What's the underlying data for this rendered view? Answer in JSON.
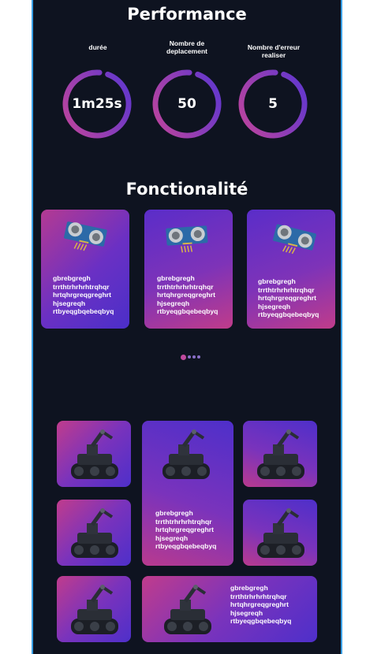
{
  "performance": {
    "title": "Performance",
    "metrics": [
      {
        "label_line1": "durée",
        "label_line2": "",
        "value": "1m25s"
      },
      {
        "label_line1": "Nombre de",
        "label_line2": "deplacement",
        "value": "50"
      },
      {
        "label_line1": "Nombre d'erreur",
        "label_line2": "realiser",
        "value": "5"
      }
    ]
  },
  "features": {
    "title": "Fonctionalité",
    "card_text_lines": [
      "gbrebgregh",
      "trrthtrhrhrhtrqhqr",
      "hrtqhrgreqgreghrt",
      "hjsegreqh",
      "rtbyeqgbqebeqbyq"
    ],
    "carousel_dots": 4,
    "active_dot": 0
  },
  "gallery": {
    "text_lines": [
      "gbrebgregh",
      "trrthtrhrhrhtrqhqr",
      "hrtqhrgreqgreghrt",
      "hjsegreqh",
      "rtbyeqgbqebeqbyq"
    ]
  },
  "colors": {
    "background": "#0e1320",
    "frame_border": "#3aa0e6",
    "gauge_start": "#c2449a",
    "gauge_end": "#5a36d2",
    "dot_active": "#c04a9e"
  },
  "icons": {
    "sensor": "ultrasonic-sensor-icon",
    "robot": "robot-arm-tank-icon"
  }
}
